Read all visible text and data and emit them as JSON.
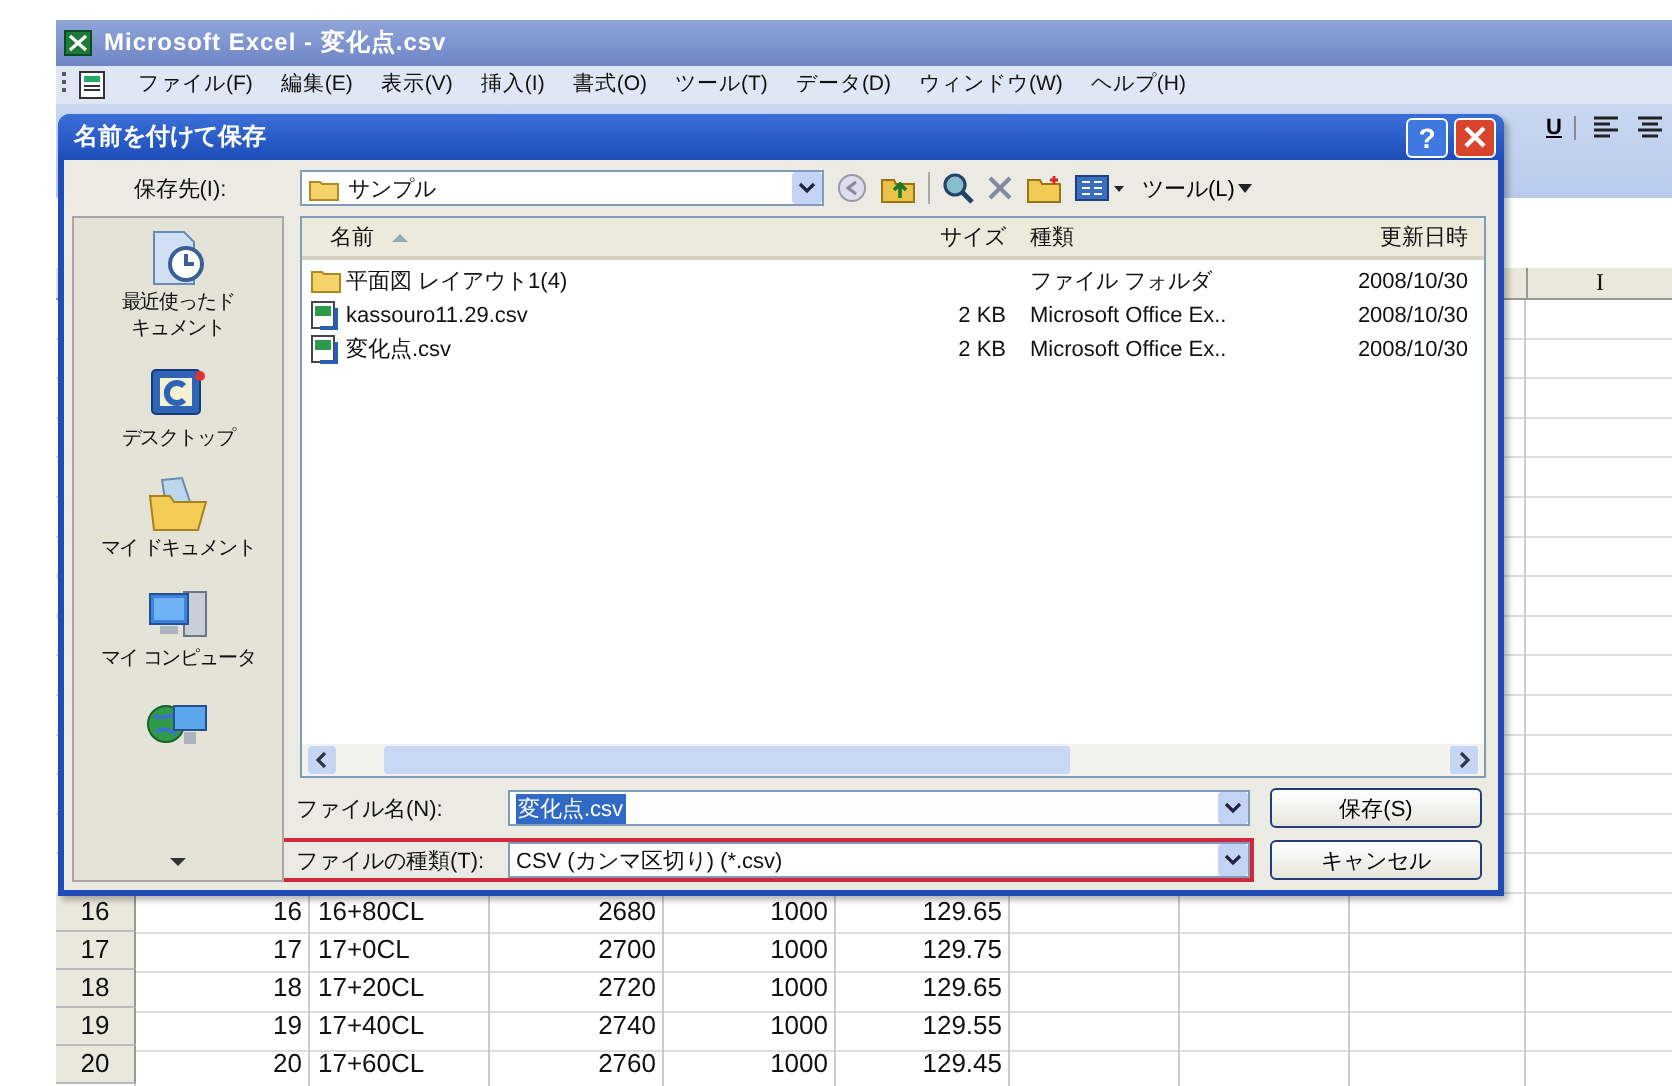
{
  "window": {
    "title": "Microsoft Excel - 変化点.csv"
  },
  "menu": [
    "ファイル(F)",
    "編集(E)",
    "表示(V)",
    "挿入(I)",
    "書式(O)",
    "ツール(T)",
    "データ(D)",
    "ウィンドウ(W)",
    "ヘルプ(H)"
  ],
  "toolbar": {
    "underline": "U"
  },
  "sheet": {
    "visible_column": "I",
    "rows": [
      {
        "header": "16",
        "cells": [
          "16",
          "16+80CL",
          "2680",
          "1000",
          "129.65"
        ]
      },
      {
        "header": "17",
        "cells": [
          "17",
          "17+0CL",
          "2700",
          "1000",
          "129.75"
        ]
      },
      {
        "header": "18",
        "cells": [
          "18",
          "17+20CL",
          "2720",
          "1000",
          "129.65"
        ]
      },
      {
        "header": "19",
        "cells": [
          "19",
          "17+40CL",
          "2740",
          "1000",
          "129.55"
        ]
      },
      {
        "header": "20",
        "cells": [
          "20",
          "17+60CL",
          "2760",
          "1000",
          "129.45"
        ]
      }
    ]
  },
  "dialog": {
    "title": "名前を付けて保存",
    "help": "?",
    "save_in": {
      "label": "保存先(I):",
      "value": "サンプル"
    },
    "tools_menu": "ツール(L)",
    "places": [
      {
        "kind": "recent",
        "label": "最近使ったドキュメント"
      },
      {
        "kind": "desktop",
        "label": "デスクトップ"
      },
      {
        "kind": "documents",
        "label": "マイ ドキュメント"
      },
      {
        "kind": "computer",
        "label": "マイ コンピュータ"
      },
      {
        "kind": "network"
      }
    ],
    "columns": [
      "名前",
      "サイズ",
      "種類",
      "更新日時"
    ],
    "files": [
      {
        "kind": "folder",
        "name": "平面図 レイアウト1(4)",
        "type": "ファイル フォルダ",
        "modified": "2008/10/30"
      },
      {
        "kind": "csv",
        "name": "kassouro11.29.csv",
        "size": "2 KB",
        "type": "Microsoft Office Ex..",
        "modified": "2008/10/30"
      },
      {
        "kind": "csv",
        "name": "変化点.csv",
        "size": "2 KB",
        "type": "Microsoft Office Ex..",
        "modified": "2008/10/30"
      }
    ],
    "file_name": {
      "label": "ファイル名(N):",
      "value": "変化点.csv",
      "selected": true
    },
    "file_type": {
      "label": "ファイルの種類(T):",
      "value": "CSV (カンマ区切り) (*.csv)",
      "highlighted": true
    },
    "buttons": {
      "save": "保存(S)",
      "cancel": "キャンセル"
    }
  }
}
